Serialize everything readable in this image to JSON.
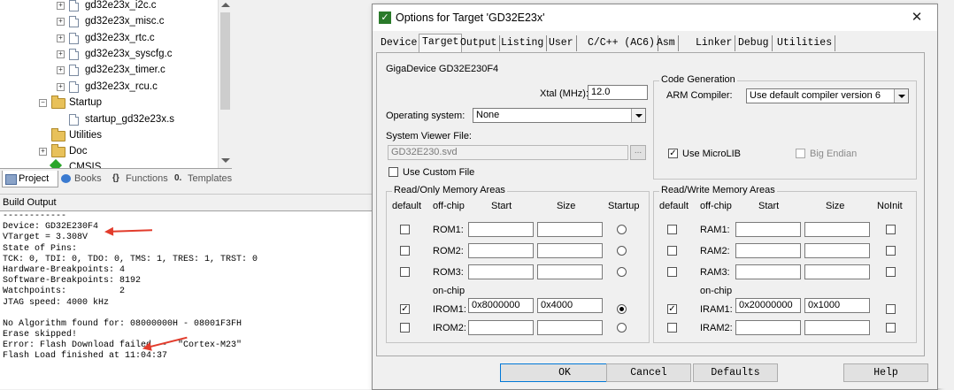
{
  "project_tree": {
    "files": [
      "gd32e23x_i2c.c",
      "gd32e23x_misc.c",
      "gd32e23x_rtc.c",
      "gd32e23x_syscfg.c",
      "gd32e23x_timer.c",
      "gd32e23x_rcu.c"
    ],
    "startup_folder": "Startup",
    "startup_file": "startup_gd32e23x.s",
    "utilities_folder": "Utilities",
    "doc_folder": "Doc",
    "cmsis_item": "CMSIS"
  },
  "bottom_tabs": [
    "Project",
    "Books",
    "Functions",
    "Templates"
  ],
  "build_output": {
    "title": "Build Output",
    "lines": [
      "------------",
      "Device: GD32E230F4",
      "VTarget = 3.308V",
      "State of Pins:",
      "TCK: 0, TDI: 0, TDO: 0, TMS: 1, TRES: 1, TRST: 0",
      "Hardware-Breakpoints: 4",
      "Software-Breakpoints: 8192",
      "Watchpoints:          2",
      "JTAG speed: 4000 kHz",
      "",
      "No Algorithm found for: 08000000H - 08001F3FH",
      "Erase skipped!",
      "Error: Flash Download failed  -  \"Cortex-M23\"",
      "Flash Load finished at 11:04:37"
    ],
    "arrow_color": "#e23c2c"
  },
  "dialog": {
    "title": "Options for Target 'GD32E23x'",
    "tabs": [
      "Device",
      "Target",
      "Output",
      "Listing",
      "User",
      "C/C++ (AC6)",
      "Asm",
      "Linker",
      "Debug",
      "Utilities"
    ],
    "active_tab": "Target",
    "device_name": "GigaDevice GD32E230F4",
    "xtal_label": "Xtal (MHz):",
    "xtal_value": "12.0",
    "os_label": "Operating system:",
    "os_value": "None",
    "svf_label": "System Viewer File:",
    "svf_value": "GD32E230.svd",
    "use_custom_file": "Use Custom File",
    "codegen": {
      "title": "Code Generation",
      "compiler_label": "ARM Compiler:",
      "compiler_value": "Use default compiler version 6",
      "microlib": "Use MicroLIB",
      "big_endian": "Big Endian"
    },
    "ro": {
      "title": "Read/Only Memory Areas",
      "headers": [
        "default",
        "off-chip",
        "Start",
        "Size",
        "Startup"
      ],
      "onchip_label": "on-chip",
      "rows": [
        {
          "name": "ROM1:",
          "start": "",
          "size": ""
        },
        {
          "name": "ROM2:",
          "start": "",
          "size": ""
        },
        {
          "name": "ROM3:",
          "start": "",
          "size": ""
        },
        {
          "name": "IROM1:",
          "start": "0x8000000",
          "size": "0x4000"
        },
        {
          "name": "IROM2:",
          "start": "",
          "size": ""
        }
      ]
    },
    "rw": {
      "title": "Read/Write Memory Areas",
      "headers": [
        "default",
        "off-chip",
        "Start",
        "Size",
        "NoInit"
      ],
      "onchip_label": "on-chip",
      "rows": [
        {
          "name": "RAM1:",
          "start": "",
          "size": ""
        },
        {
          "name": "RAM2:",
          "start": "",
          "size": ""
        },
        {
          "name": "RAM3:",
          "start": "",
          "size": ""
        },
        {
          "name": "IRAM1:",
          "start": "0x20000000",
          "size": "0x1000"
        },
        {
          "name": "IRAM2:",
          "start": "",
          "size": ""
        }
      ]
    },
    "buttons": {
      "ok": "OK",
      "cancel": "Cancel",
      "defaults": "Defaults",
      "help": "Help"
    }
  }
}
